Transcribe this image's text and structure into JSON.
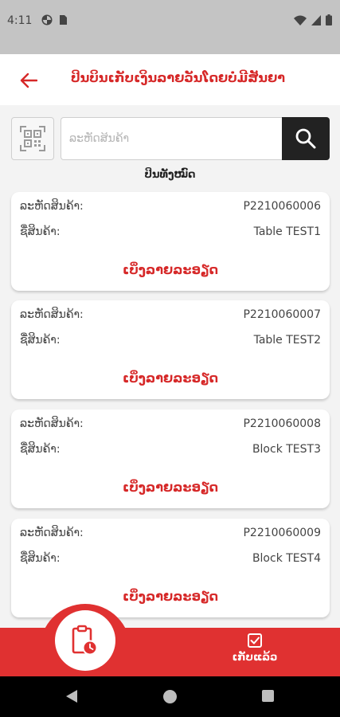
{
  "status_bar": {
    "time": "4:11",
    "icons": [
      "pinwheel-icon",
      "sim-card-icon",
      "wifi-icon",
      "signal-icon",
      "battery-icon"
    ]
  },
  "app_bar": {
    "title": "ປິນບິນເກັບເງິນລາຍວັນໂດຍບໍ່ມີສັນຍາ",
    "back_icon": "arrow-left-icon"
  },
  "search": {
    "placeholder": "ລະຫັດສິນຄ້າ",
    "value": "",
    "qr_icon": "qr-scan-icon",
    "search_icon": "search-icon"
  },
  "filter_label": "ປິນທັງໝົດ",
  "cards": [
    {
      "code_label": "ລະຫັດສິນຄ້າ:",
      "code": "P2210060006",
      "name_label": "ຊື່ສິນຄ້າ:",
      "name": "Table TEST1",
      "link": "ເບິ່ງລາຍລະອຽດ"
    },
    {
      "code_label": "ລະຫັດສິນຄ້າ:",
      "code": "P2210060007",
      "name_label": "ຊື່ສິນຄ້າ:",
      "name": "Table TEST2",
      "link": "ເບິ່ງລາຍລະອຽດ"
    },
    {
      "code_label": "ລະຫັດສິນຄ້າ:",
      "code": "P2210060008",
      "name_label": "ຊື່ສິນຄ້າ:",
      "name": "Block TEST3",
      "link": "ເບິ່ງລາຍລະອຽດ"
    },
    {
      "code_label": "ລະຫັດສິນຄ້າ:",
      "code": "P2210060009",
      "name_label": "ຊື່ສິນຄ້າ:",
      "name": "Block TEST4",
      "link": "ເບິ່ງລາຍລະອຽດ"
    }
  ],
  "bottom_nav": {
    "fab_icon": "clipboard-clock-icon",
    "completed_icon": "check-square-icon",
    "completed_label": "ເກັບແລ້ວ"
  },
  "colors": {
    "accent": "#d62828",
    "nav_bg": "#e03131",
    "search_btn": "#222222"
  }
}
